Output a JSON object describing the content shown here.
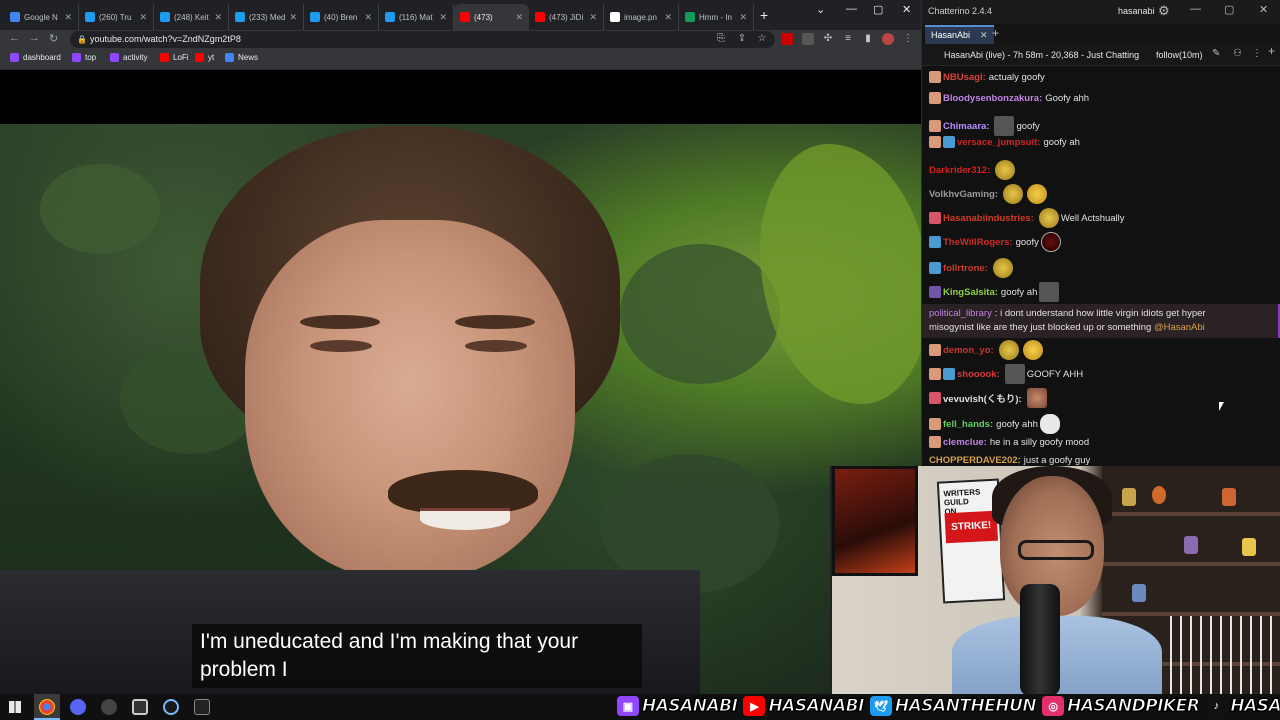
{
  "browser": {
    "tabs": [
      {
        "title": "Google N",
        "color": "#4285f4",
        "active": false
      },
      {
        "title": "(260) Tru",
        "color": "#1d9bf0",
        "active": false
      },
      {
        "title": "(248) Keit",
        "color": "#1d9bf0",
        "active": false
      },
      {
        "title": "(233) Med",
        "color": "#1d9bf0",
        "active": false
      },
      {
        "title": "(40) Bren",
        "color": "#1d9bf0",
        "active": false
      },
      {
        "title": "(116) Mat",
        "color": "#1d9bf0",
        "active": false
      },
      {
        "title": "(473)",
        "color": "#ff0000",
        "active": true
      },
      {
        "title": "(473) JiDi",
        "color": "#ff0000",
        "active": false
      },
      {
        "title": "image.pn",
        "color": "#ffffff",
        "active": false
      },
      {
        "title": "Hmm - In",
        "color": "#0f9d58",
        "active": false
      }
    ],
    "new_tab": "+",
    "url": "youtube.com/watch?v=ZndNZgm2tP8",
    "bookmarks": [
      {
        "label": "dashboard",
        "color": "#9146ff"
      },
      {
        "label": "top",
        "color": "#9146ff"
      },
      {
        "label": "activity",
        "color": "#9146ff"
      },
      {
        "label": "LoFi",
        "color": "#ff0000"
      },
      {
        "label": "yt",
        "color": "#ff0000"
      },
      {
        "label": "News",
        "color": "#4285f4"
      }
    ]
  },
  "video": {
    "subtitle": "I'm uneducated and I'm making that your problem I"
  },
  "chatterino": {
    "app_title": "Chatterino 2.4.4",
    "user": "hasanabi",
    "tab": "HasanAbi",
    "stream_info": "HasanAbi (live) - 7h 58m - 20,368 - Just Chatting",
    "follow": "follow(10m)",
    "messages": [
      {
        "name": "NBUsagi",
        "sep": ":",
        "color": "#d2473a",
        "badges": [
          "hand"
        ],
        "text": "actualy goofy",
        "emotes": []
      },
      {
        "name": "Bloodysenbonzakura",
        "sep": ":",
        "color": "#c184e6",
        "badges": [
          "face"
        ],
        "text": "Goofy ahh",
        "emotes": []
      },
      {
        "name": "Chimaara",
        "sep": ":",
        "color": "#b98dff",
        "badges": [
          "hand"
        ],
        "text": "goofy",
        "emotes": [
          "sq"
        ]
      },
      {
        "name": "versace_jumpsuit",
        "sep": ":",
        "color": "#d02626",
        "badges": [
          "hand",
          "sub"
        ],
        "text": "goofy ah",
        "emotes": []
      },
      {
        "name": "Darkrider312",
        "sep": ":",
        "color": "#d32020",
        "badges": [],
        "text": "",
        "emotes": [
          "gold"
        ]
      },
      {
        "name": "VolkhvGaming",
        "sep": ":",
        "color": "#9a9a9a",
        "badges": [],
        "text": "",
        "emotes": [
          "gold",
          "fist"
        ]
      },
      {
        "name": "Hasanabiindustries",
        "sep": ":",
        "color": "#d23a2a",
        "badges": [
          "gift"
        ],
        "text": "Well Actshually",
        "emotes": [
          "gold"
        ]
      },
      {
        "name": "TheWillRogers",
        "sep": ":",
        "color": "#d12a2a",
        "badges": [
          "sub"
        ],
        "text": "goofy",
        "emotes": [
          "dark"
        ]
      },
      {
        "name": "follrtrone",
        "sep": ":",
        "color": "#d23a2a",
        "badges": [
          "sub"
        ],
        "text": "",
        "emotes": [
          "gold"
        ]
      },
      {
        "name": "KingSalsita",
        "sep": ":",
        "color": "#8ed14a",
        "badges": [
          "prime"
        ],
        "text": "goofy ah",
        "emotes": [
          "sq"
        ]
      },
      {
        "name": "demon_yo",
        "sep": ":",
        "color": "#d23030",
        "badges": [
          "hand"
        ],
        "text": "",
        "emotes": [
          "gold",
          "fist"
        ]
      },
      {
        "name": "shooook",
        "sep": ":",
        "color": "#d83a3a",
        "badges": [
          "hand",
          "sub"
        ],
        "text": "GOOFY AHH",
        "emotes": [
          "sq"
        ]
      },
      {
        "name": "vevuvish(くもり)",
        "sep": ":",
        "color": "#e0e0e0",
        "badges": [
          "gift"
        ],
        "text": "",
        "emotes": [
          "face"
        ]
      },
      {
        "name": "fell_hands",
        "sep": ":",
        "color": "#5fd15f",
        "badges": [
          "hand"
        ],
        "text": "goofy ahh",
        "emotes": [
          "skull"
        ]
      },
      {
        "name": "clemclue",
        "sep": ":",
        "color": "#c184e6",
        "badges": [
          "face"
        ],
        "text": "he in a silly goofy mood",
        "emotes": []
      },
      {
        "name": "CHOPPERDAVE202",
        "sep": ":",
        "color": "#d8a04a",
        "badges": [],
        "text": "just a goofy guy",
        "emotes": []
      }
    ],
    "highlight": {
      "name": "political_library",
      "sep": ":",
      "line1": "i dont understand how little virgin idiots get hyper",
      "line2": "misogynist like are they just blocked up or something",
      "mention": "@HasanAbi"
    }
  },
  "webcam": {
    "sign_line1": "WRITERS GUILD",
    "sign_line2": "ON",
    "sign_strike": "STRIKE!"
  },
  "socials": [
    {
      "platform": "twitch",
      "handle": "HASANABI",
      "color": "#9146ff",
      "icon": "twitch-icon"
    },
    {
      "platform": "youtube",
      "handle": "HASANABI",
      "color": "#ff0000",
      "icon": "youtube-icon"
    },
    {
      "platform": "twitter",
      "handle": "HASANTHEHUN",
      "color": "#1d9bf0",
      "icon": "twitter-icon"
    },
    {
      "platform": "instagram",
      "handle": "HASANDPIKER",
      "color": "#e1306c",
      "icon": "instagram-icon"
    },
    {
      "platform": "tiktok",
      "handle": "HASANDPIKER",
      "color": "#111111",
      "icon": "tiktok-icon"
    }
  ]
}
